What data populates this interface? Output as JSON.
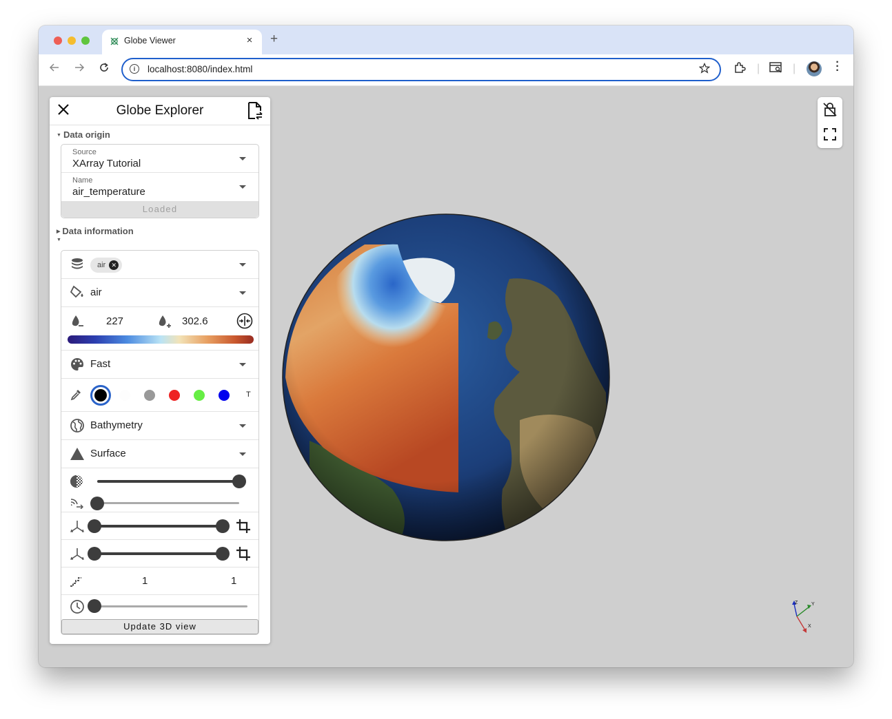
{
  "browser": {
    "tab_title": "Globe Viewer",
    "tab_close": "×",
    "new_tab": "+",
    "url": "localhost:8080/index.html",
    "back_icon": "arrow-left-icon",
    "forward_icon": "arrow-right-icon",
    "reload_icon": "reload-icon",
    "star_icon": "star-icon"
  },
  "panel": {
    "title": "Globe Explorer",
    "data_origin": {
      "label": "Data origin",
      "source_label": "Source",
      "source_value": "XArray Tutorial",
      "name_label": "Name",
      "name_value": "air_temperature",
      "loaded_button": "Loaded"
    },
    "data_information": {
      "label": "Data information"
    },
    "fields_chip": "air",
    "color_by": "air",
    "range": {
      "min": "227",
      "max": "302.6"
    },
    "colormap": "Fast",
    "colors": {
      "selected": "#000000",
      "swatches": [
        "#ffffff",
        "#999999",
        "#ee2222",
        "#66ee44",
        "#0000ee"
      ],
      "transparent_label": "T"
    },
    "texture": "Bathymetry",
    "representation": "Surface",
    "sliders": {
      "opacity": 1.0,
      "scale": 0.0,
      "crop_range_1": [
        0.0,
        1.0
      ],
      "crop_range_2": [
        0.0,
        1.0
      ],
      "time": 0.0
    },
    "step": {
      "left": "1",
      "right": "1"
    },
    "update_button": "Update 3D view"
  },
  "viewport": {
    "background": "#cfcfcf",
    "axes": {
      "x": "X",
      "y": "Y",
      "z": "Z"
    }
  }
}
